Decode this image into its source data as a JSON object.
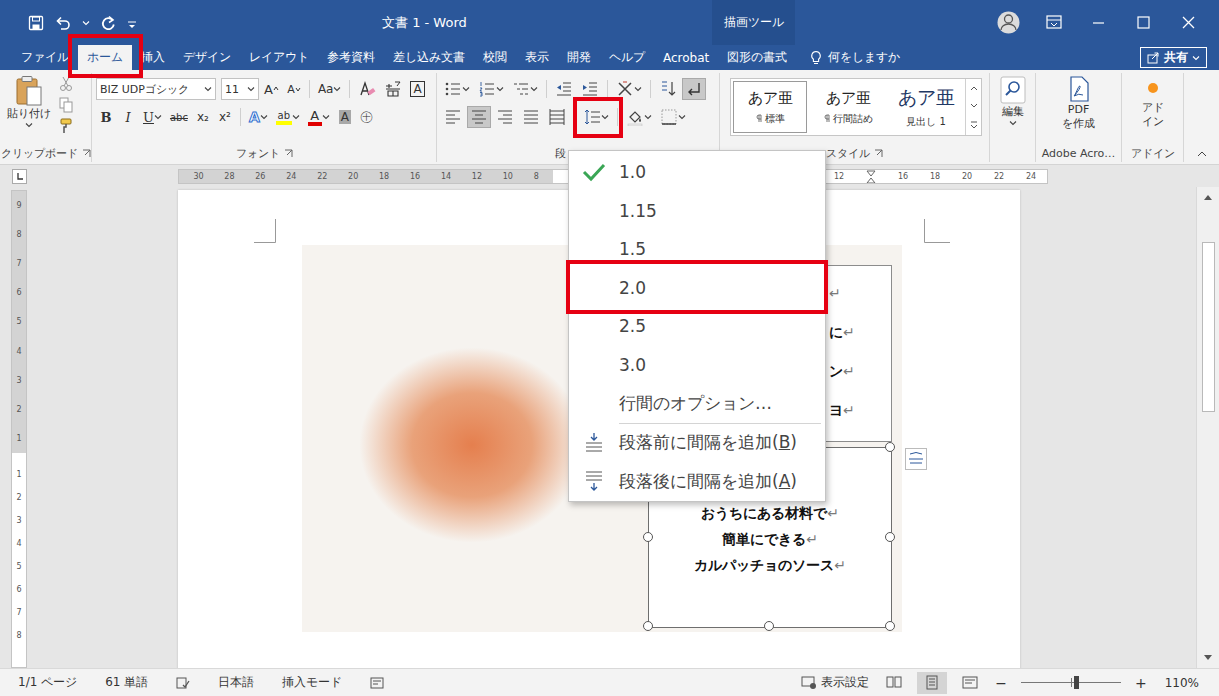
{
  "window": {
    "title": "文書 1 - Word",
    "context_label": "描画ツール"
  },
  "tabs": [
    {
      "label": "ファイル",
      "selected": false,
      "highlighted": false
    },
    {
      "label": "ホーム",
      "selected": true,
      "highlighted": true
    },
    {
      "label": "挿入",
      "selected": false,
      "highlighted": false
    },
    {
      "label": "デザイン",
      "selected": false,
      "highlighted": false
    },
    {
      "label": "レイアウト",
      "selected": false,
      "highlighted": false
    },
    {
      "label": "参考資料",
      "selected": false,
      "highlighted": false
    },
    {
      "label": "差し込み文書",
      "selected": false,
      "highlighted": false
    },
    {
      "label": "校閲",
      "selected": false,
      "highlighted": false
    },
    {
      "label": "表示",
      "selected": false,
      "highlighted": false
    },
    {
      "label": "開発",
      "selected": false,
      "highlighted": false
    },
    {
      "label": "ヘルプ",
      "selected": false,
      "highlighted": false
    },
    {
      "label": "Acrobat",
      "selected": false,
      "highlighted": false
    },
    {
      "label": "図形の書式",
      "selected": false,
      "highlighted": false
    }
  ],
  "tell_me": {
    "label": "何をしますか"
  },
  "share": {
    "label": "共有"
  },
  "ribbon": {
    "clipboard": {
      "label": "クリップボード",
      "paste": "貼り付け"
    },
    "font": {
      "label": "フォント",
      "name": "BIZ UDPゴシック",
      "size": "11",
      "grow": "A",
      "shrink": "A",
      "case": "Aa",
      "border": "A",
      "bold": "B",
      "italic": "I",
      "underline": "U",
      "strike": "abc",
      "subscript": "x₂",
      "superscript": "x²",
      "effects": "A",
      "highlight": "ab",
      "color": "A",
      "shading": "A",
      "enclose": "㊉"
    },
    "paragraph": {
      "label": "段",
      "align": [
        {
          "selected": false
        },
        {
          "selected": true
        },
        {
          "selected": false
        },
        {
          "selected": false
        },
        {
          "selected": false
        }
      ],
      "show_marks": {
        "on": true
      },
      "line_spacing": {
        "highlighted": true
      }
    },
    "styles": {
      "label": "スタイル",
      "items": [
        {
          "preview": "あア亜",
          "name": "標準",
          "selected": true,
          "paragraph_style": true
        },
        {
          "preview": "あア亜",
          "name": "行間詰め",
          "selected": false,
          "paragraph_style": true
        },
        {
          "preview": "あア亜",
          "name": "見出し 1",
          "selected": false,
          "paragraph_style": false
        }
      ]
    },
    "editing": {
      "label": "編集"
    },
    "adobe": {
      "label": "Adobe Acro…",
      "button": [
        "PDF",
        "を作成"
      ]
    },
    "addins": {
      "label": "アドイン",
      "button": [
        "アド",
        "イン"
      ]
    }
  },
  "ruler": {
    "horizontal_left": [
      "30",
      "28",
      "26",
      "24",
      "22",
      "20",
      "18",
      "16",
      "14",
      "12",
      "10",
      "8"
    ],
    "horizontal_right": [
      "12",
      "16",
      "18",
      "20",
      "22",
      "24"
    ],
    "vertical_top": [
      "9",
      "8",
      "7",
      "6",
      "5",
      "4",
      "3",
      "2",
      "1"
    ],
    "vertical_bottom": [
      "1",
      "2",
      "3",
      "4",
      "5",
      "6",
      "7",
      "8"
    ]
  },
  "line_spacing_menu": {
    "options": [
      {
        "label": "1.0",
        "checked": true,
        "highlighted": false
      },
      {
        "label": "1.15",
        "checked": false,
        "highlighted": false
      },
      {
        "label": "1.5",
        "checked": false,
        "highlighted": false
      },
      {
        "label": "2.0",
        "checked": false,
        "highlighted": true
      },
      {
        "label": "2.5",
        "checked": false,
        "highlighted": false
      },
      {
        "label": "3.0",
        "checked": false,
        "highlighted": false
      }
    ],
    "more": "行間のオプション…",
    "actions": [
      {
        "label": "段落前に間隔を追加(B)",
        "mnemonic": "B",
        "kind": "before"
      },
      {
        "label": "段落後に間隔を追加(A)",
        "mnemonic": "A",
        "kind": "after"
      }
    ]
  },
  "document": {
    "text_box_1": {
      "lines": [
        "↵",
        "に↵",
        "ン↵",
        "ヨ↵"
      ]
    },
    "text_box_2": {
      "lines": [
        "おうちにある材料で↵",
        "簡単にできる↵",
        "カルパッチョのソース↵"
      ],
      "selected": true
    }
  },
  "status_bar": {
    "page": "1/1 ページ",
    "words": "61 単語",
    "language": "日本語",
    "mode": "挿入モード",
    "display_settings": "表示設定",
    "views": [
      {
        "selected": false
      },
      {
        "selected": true
      },
      {
        "selected": false
      }
    ],
    "zoom_minus": "−",
    "zoom_plus": "+",
    "zoom_level": 0.55,
    "zoom": "110%"
  }
}
